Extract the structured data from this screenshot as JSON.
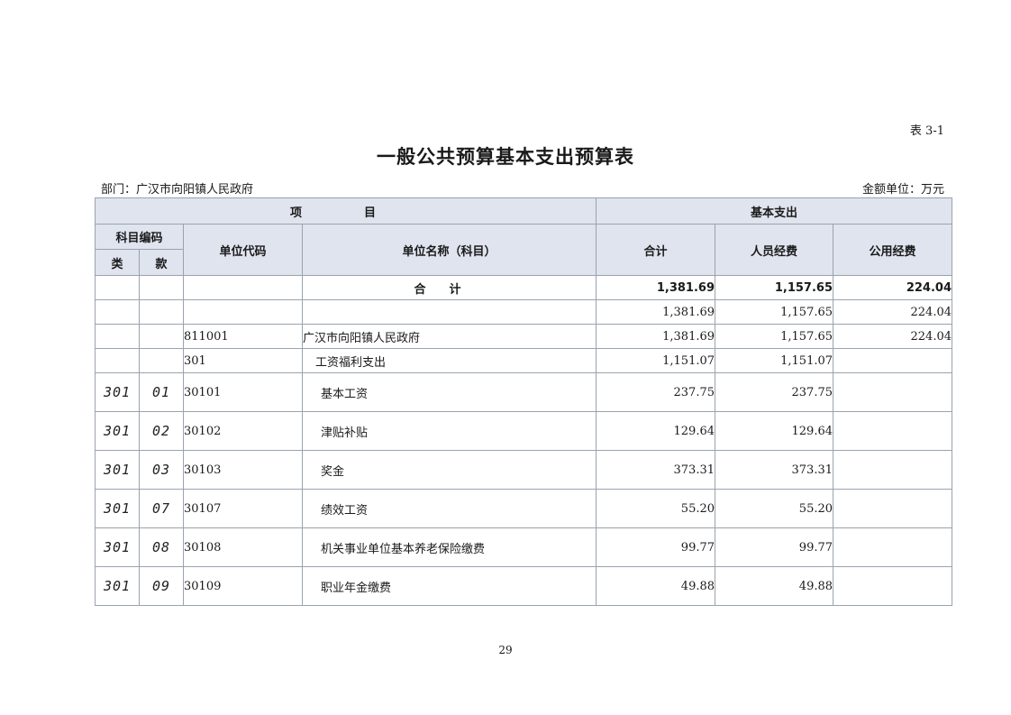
{
  "table_no": "表 3-1",
  "title": "一般公共预算基本支出预算表",
  "department": "部门：广汉市向阳镇人民政府",
  "amount_unit": "金额单位：万元",
  "headers": {
    "project": "项　目",
    "basic_expenditure": "基本支出",
    "subject_code": "科目编码",
    "category": "类",
    "item": "款",
    "unit_code": "单位代码",
    "unit_name": "单位名称（科目）",
    "total": "合计",
    "personnel": "人员经费",
    "public": "公用经费"
  },
  "rows": [
    {
      "cat": "",
      "item": "",
      "code": "",
      "name": "合计",
      "total": "1,381.69",
      "personnel": "1,157.65",
      "public": "224.04"
    },
    {
      "cat": "",
      "item": "",
      "code": "",
      "name": "",
      "total": "1,381.69",
      "personnel": "1,157.65",
      "public": "224.04"
    },
    {
      "cat": "",
      "item": "",
      "code": "811001",
      "name": "广汉市向阳镇人民政府",
      "total": "1,381.69",
      "personnel": "1,157.65",
      "public": "224.04"
    },
    {
      "cat": "",
      "item": "",
      "code": "301",
      "name": "工资福利支出",
      "total": "1,151.07",
      "personnel": "1,151.07",
      "public": ""
    },
    {
      "cat": "301",
      "item": "01",
      "code": "30101",
      "name": "基本工资",
      "total": "237.75",
      "personnel": "237.75",
      "public": ""
    },
    {
      "cat": "301",
      "item": "02",
      "code": "30102",
      "name": "津贴补贴",
      "total": "129.64",
      "personnel": "129.64",
      "public": ""
    },
    {
      "cat": "301",
      "item": "03",
      "code": "30103",
      "name": "奖金",
      "total": "373.31",
      "personnel": "373.31",
      "public": ""
    },
    {
      "cat": "301",
      "item": "07",
      "code": "30107",
      "name": "绩效工资",
      "total": "55.20",
      "personnel": "55.20",
      "public": ""
    },
    {
      "cat": "301",
      "item": "08",
      "code": "30108",
      "name": "机关事业单位基本养老保险缴费",
      "total": "99.77",
      "personnel": "99.77",
      "public": ""
    },
    {
      "cat": "301",
      "item": "09",
      "code": "30109",
      "name": "职业年金缴费",
      "total": "49.88",
      "personnel": "49.88",
      "public": ""
    }
  ],
  "page_number": "29"
}
